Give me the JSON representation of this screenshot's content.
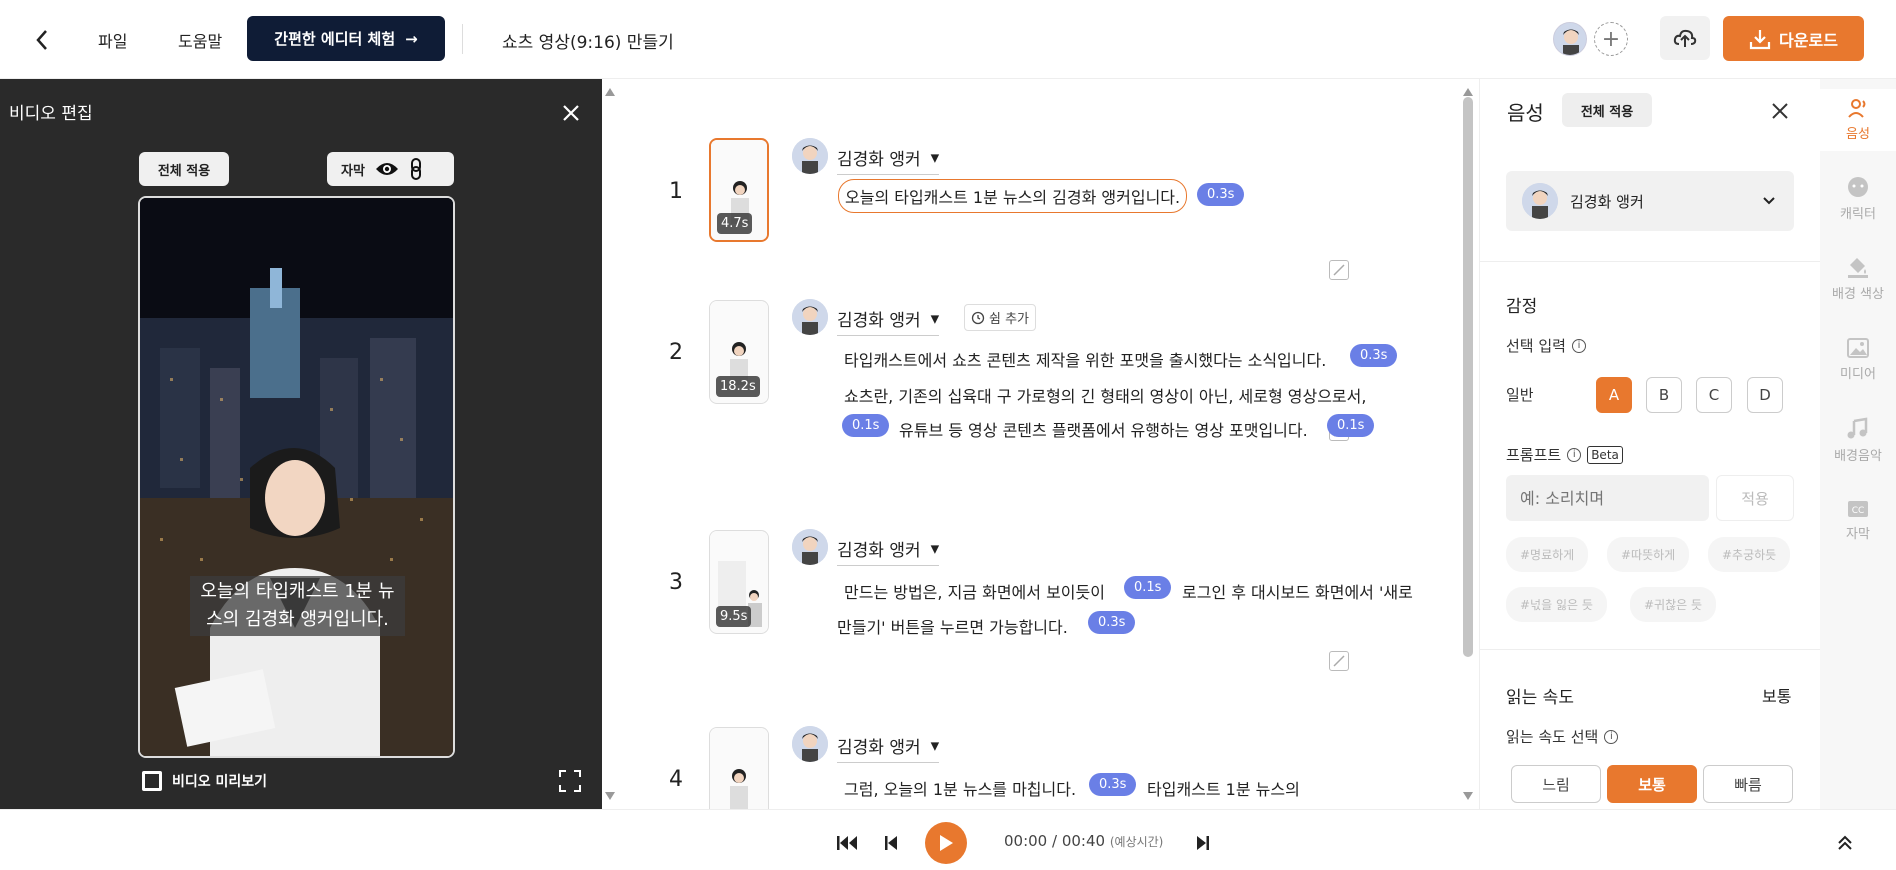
{
  "topbar": {
    "menu_file": "파일",
    "menu_help": "도움말",
    "try_editor": "간편한 에디터 체험",
    "doc_title": "쇼츠 영상(9:16) 만들기",
    "download": "다운로드"
  },
  "video_panel": {
    "title": "비디오 편집",
    "apply_all": "전체 적용",
    "subtitle_label": "자막",
    "caption": "오늘의 타입캐스트 1분 뉴스의 김경화 앵커입니다.",
    "preview_label": "비디오 미리보기"
  },
  "script": {
    "pause_add": "쉼 추가",
    "rows": [
      {
        "num": "1",
        "duration": "4.7s",
        "speaker": "김경화 앵커",
        "line1": "오늘의 타입캐스트 1분 뉴스의 김경화 앵커입니다.",
        "pill1": "0.3s"
      },
      {
        "num": "2",
        "duration": "18.2s",
        "speaker": "김경화 앵커",
        "line1": "타입캐스트에서 쇼츠 콘텐츠 제작을 위한 포맷을 출시했다는 소식입니다.",
        "pill1": "0.3s",
        "line2": "쇼츠란, 기존의 십육대 구 가로형의 긴 형태의 영상이 아닌, 세로형 영상으로서,",
        "pill2": "0.1s",
        "line3": "유튜브 등 영상 콘텐츠 플랫폼에서 유행하는 영상 포맷입니다.",
        "pill3": "0.1s"
      },
      {
        "num": "3",
        "duration": "9.5s",
        "speaker": "김경화 앵커",
        "line1a": "만드는 방법은, 지금 화면에서 보이듯이",
        "pill1": "0.1s",
        "line1b": "로그인 후 대시보드 화면에서 '새로",
        "line2": "만들기' 버튼을 누르면 가능합니다.",
        "pill2": "0.3s"
      },
      {
        "num": "4",
        "speaker": "김경화 앵커",
        "line1a": "그럼, 오늘의 1분 뉴스를 마칩니다.",
        "pill1": "0.3s",
        "line1b": "타입캐스트 1분 뉴스의"
      }
    ]
  },
  "voice_panel": {
    "title": "음성",
    "apply_all": "전체 적용",
    "selected_voice": "김경화 앵커",
    "emotion_title": "감정",
    "select_input": "선택 입력",
    "general": "일반",
    "letters": [
      "A",
      "B",
      "C",
      "D"
    ],
    "prompt_label": "프롬프트",
    "beta": "Beta",
    "prompt_placeholder": "예: 소리치며",
    "prompt_apply": "적용",
    "tags": [
      "#명료하게",
      "#따뜻하게",
      "#추궁하듯",
      "#넋을 잃은 듯",
      "#귀찮은 듯"
    ],
    "speed_title": "읽는 속도",
    "speed_value": "보통",
    "speed_select": "읽는 속도 선택",
    "speeds": [
      "느림",
      "보통",
      "빠름"
    ]
  },
  "rail": {
    "items": [
      "음성",
      "캐릭터",
      "배경 색상",
      "미디어",
      "배경음악",
      "자막"
    ]
  },
  "player": {
    "current": "00:00",
    "sep": " / ",
    "total": "00:40",
    "estimate": "(예상시간)"
  },
  "colors": {
    "accent": "#e8782e",
    "pill": "#6a7fe6",
    "dark_button": "#0f1c36"
  }
}
